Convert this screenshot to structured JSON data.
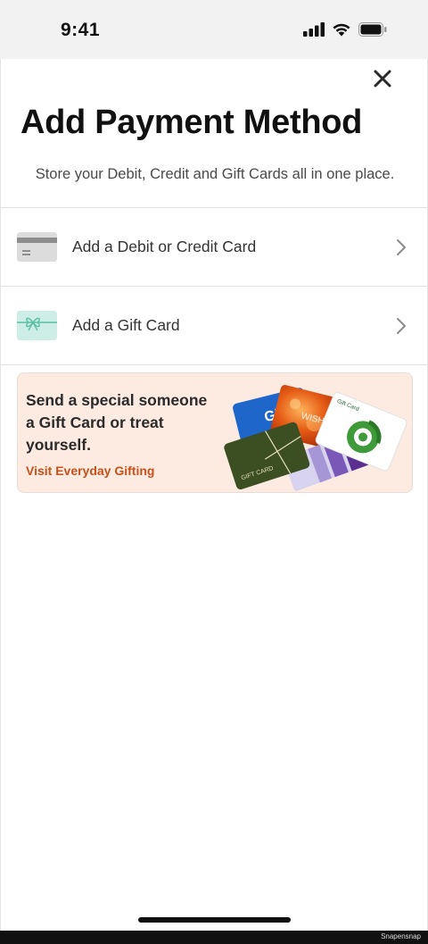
{
  "status_bar": {
    "time": "9:41"
  },
  "sheet": {
    "title": "Add Payment Method",
    "subtitle": "Store your Debit, Credit and Gift Cards all in one place."
  },
  "options": [
    {
      "label": "Add a Debit or Credit Card",
      "icon": "credit-card-icon"
    },
    {
      "label": "Add a Gift Card",
      "icon": "gift-card-icon"
    }
  ],
  "promo": {
    "heading": "Send a special someone a Gift Card or treat yourself.",
    "link": "Visit Everyday Gifting",
    "card_labels": [
      "Gift Card",
      "WISH",
      "Gift Card",
      "GIFT CARD"
    ]
  },
  "footer": {
    "brand": "Snapensnap"
  },
  "colors": {
    "accent": "#c8501a",
    "promo_bg": "#fdebe1",
    "gift_icon": "#cdeee6",
    "card_icon": "#dcdcdc"
  }
}
